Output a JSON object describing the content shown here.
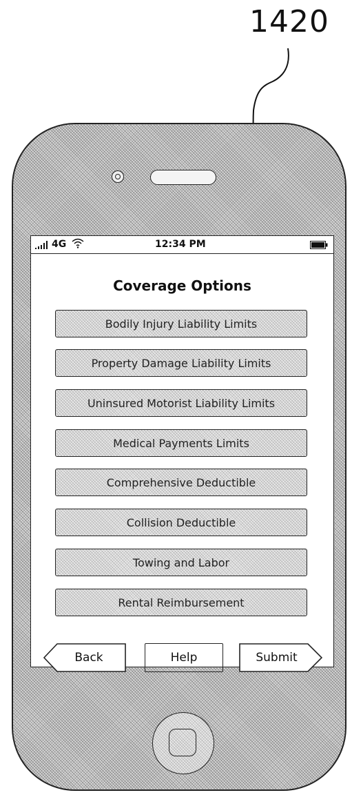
{
  "figure": {
    "reference_number": "1420"
  },
  "status_bar": {
    "network": "4G",
    "time": "12:34 PM"
  },
  "screen": {
    "title": "Coverage Options",
    "options": [
      {
        "label": "Bodily Injury Liability Limits"
      },
      {
        "label": "Property Damage Liability Limits"
      },
      {
        "label": "Uninsured Motorist Liability Limits"
      },
      {
        "label": "Medical Payments Limits"
      },
      {
        "label": "Comprehensive Deductible"
      },
      {
        "label": "Collision Deductible"
      },
      {
        "label": "Towing and Labor"
      },
      {
        "label": "Rental Reimbursement"
      }
    ],
    "nav": {
      "back_label": "Back",
      "help_label": "Help",
      "submit_label": "Submit"
    }
  },
  "icons": [
    "signal-bars-icon",
    "wifi-icon",
    "battery-icon",
    "camera-icon",
    "speaker-icon",
    "home-button-icon"
  ]
}
